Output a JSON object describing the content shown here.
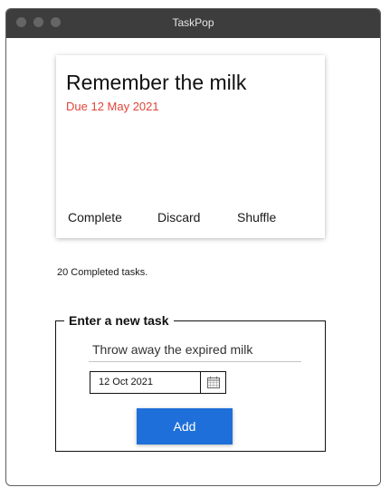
{
  "window": {
    "title": "TaskPop"
  },
  "card": {
    "title": "Remember the milk",
    "due": "Due 12 May 2021",
    "actions": [
      "Complete",
      "Discard",
      "Shuffle"
    ]
  },
  "status": {
    "completed_text": "20 Completed tasks."
  },
  "new_task": {
    "legend": "Enter a new task",
    "task_value": "Throw away the expired milk",
    "date_value": "12 Oct 2021",
    "calendar_icon": "calendar-icon",
    "add_label": "Add"
  },
  "colors": {
    "titlebar": "#3d3d3d",
    "due_text": "#e0453a",
    "add_button": "#1e6fd9"
  }
}
